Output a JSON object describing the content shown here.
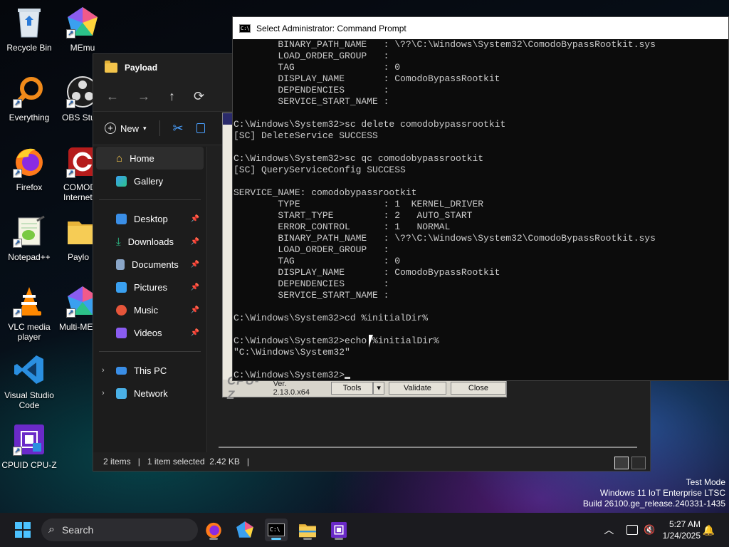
{
  "desktop": {
    "icons": [
      {
        "label": "Recycle Bin",
        "icon": "recycle-bin-icon"
      },
      {
        "label": "MEmu",
        "icon": "memu-icon"
      },
      {
        "label": "Everything",
        "icon": "everything-search-icon"
      },
      {
        "label": "OBS Stu",
        "icon": "obs-icon"
      },
      {
        "label": "Firefox",
        "icon": "firefox-icon"
      },
      {
        "label": "COMOD\nInternet",
        "icon": "comodo-icon"
      },
      {
        "label": "Notepad++",
        "icon": "notepadpp-icon"
      },
      {
        "label": "Paylo",
        "icon": "folder-icon"
      },
      {
        "label": "VLC media\nplayer",
        "icon": "vlc-icon"
      },
      {
        "label": "Multi-ME",
        "icon": "multi-memu-icon"
      },
      {
        "label": "Visual Studio\nCode",
        "icon": "vscode-icon"
      },
      {
        "label": "CPUID CPU-Z",
        "icon": "cpuz-icon"
      }
    ]
  },
  "explorer": {
    "title": "Payload",
    "new_label": "New",
    "nav": {
      "home": "Home",
      "gallery": "Gallery",
      "desktop": "Desktop",
      "downloads": "Downloads",
      "documents": "Documents",
      "pictures": "Pictures",
      "music": "Music",
      "videos": "Videos",
      "this_pc": "This PC",
      "network": "Network"
    },
    "status": {
      "items": "2 items",
      "selected": "1 item selected  2.42 KB"
    }
  },
  "cpuz": {
    "logo": "CPU-Z",
    "version": "Ver. 2.13.0.x64",
    "tools": "Tools",
    "validate": "Validate",
    "close": "Close"
  },
  "cmd": {
    "title": "Select Administrator: Command Prompt",
    "lines": [
      "        BINARY_PATH_NAME   : \\??\\C:\\Windows\\System32\\ComodoBypassRootkit.sys",
      "        LOAD_ORDER_GROUP   :",
      "        TAG                : 0",
      "        DISPLAY_NAME       : ComodoBypassRootkit",
      "        DEPENDENCIES       :",
      "        SERVICE_START_NAME :",
      "",
      "C:\\Windows\\System32>sc delete comodobypassrootkit",
      "[SC] DeleteService SUCCESS",
      "",
      "C:\\Windows\\System32>sc qc comodobypassrootkit",
      "[SC] QueryServiceConfig SUCCESS",
      "",
      "SERVICE_NAME: comodobypassrootkit",
      "        TYPE               : 1  KERNEL_DRIVER",
      "        START_TYPE         : 2   AUTO_START",
      "        ERROR_CONTROL      : 1   NORMAL",
      "        BINARY_PATH_NAME   : \\??\\C:\\Windows\\System32\\ComodoBypassRootkit.sys",
      "        LOAD_ORDER_GROUP   :",
      "        TAG                : 0",
      "        DISPLAY_NAME       : ComodoBypassRootkit",
      "        DEPENDENCIES       :",
      "        SERVICE_START_NAME :",
      "",
      "C:\\Windows\\System32>cd %initialDir%",
      "",
      "C:\\Windows\\System32>echo %initialDir%",
      "\"C:\\Windows\\System32\"",
      "",
      "C:\\Windows\\System32>"
    ]
  },
  "watermark": {
    "line1": "Test Mode",
    "line2": "Windows 11 IoT Enterprise LTSC",
    "line3": "Build 26100.ge_release.240331-1435"
  },
  "taskbar": {
    "search_placeholder": "Search",
    "time": "5:27 AM",
    "date": "1/24/2025"
  }
}
